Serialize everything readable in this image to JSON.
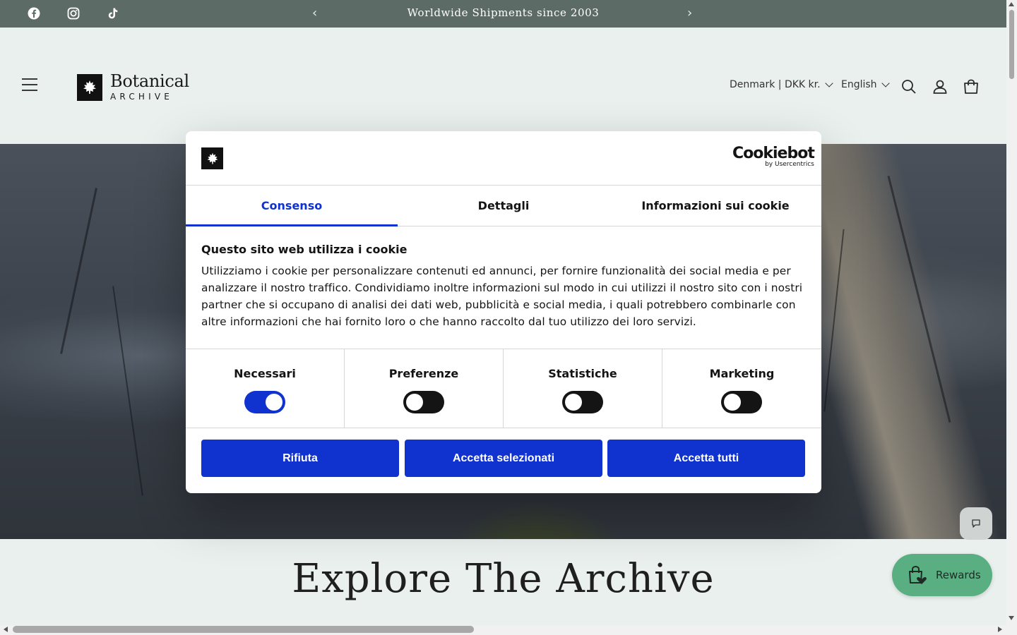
{
  "announcement": {
    "text": "Worldwide Shipments since 2003",
    "prev_icon": "‹",
    "next_icon": "›"
  },
  "social": [
    "facebook-icon",
    "instagram-icon",
    "tiktok-icon"
  ],
  "header": {
    "logo_title": "Botanical",
    "logo_subtitle": "ARCHIVE",
    "country": "Denmark | DKK kr.",
    "language": "English"
  },
  "hero": {
    "heading": "Explore The Archive"
  },
  "cookie_dialog": {
    "brand": "Cookiebot",
    "brand_sub": "by Usercentrics",
    "tabs": [
      {
        "label": "Consenso",
        "active": true
      },
      {
        "label": "Dettagli",
        "active": false
      },
      {
        "label": "Informazioni sui cookie",
        "active": false
      }
    ],
    "title": "Questo sito web utilizza i cookie",
    "body": "Utilizziamo i cookie per personalizzare contenuti ed annunci, per fornire funzionalità dei social media e per analizzare il nostro traffico. Condividiamo inoltre informazioni sul modo in cui utilizzi il nostro sito con i nostri partner che si occupano di analisi dei dati web, pubblicità e social media, i quali potrebbero combinarle con altre informazioni che hai fornito loro o che hanno raccolto dal tuo utilizzo dei loro servizi.",
    "toggles": [
      {
        "label": "Necessari",
        "on": true
      },
      {
        "label": "Preferenze",
        "on": false
      },
      {
        "label": "Statistiche",
        "on": false
      },
      {
        "label": "Marketing",
        "on": false
      }
    ],
    "buttons": {
      "reject": "Rifiuta",
      "accept_selected": "Accetta selezionati",
      "accept_all": "Accetta tutti"
    }
  },
  "rewards": {
    "label": "Rewards"
  },
  "colors": {
    "accent": "#1032cf",
    "topbar": "#5d6b66",
    "page_bg": "#eaf0ee",
    "rewards": "#5aaf82"
  }
}
